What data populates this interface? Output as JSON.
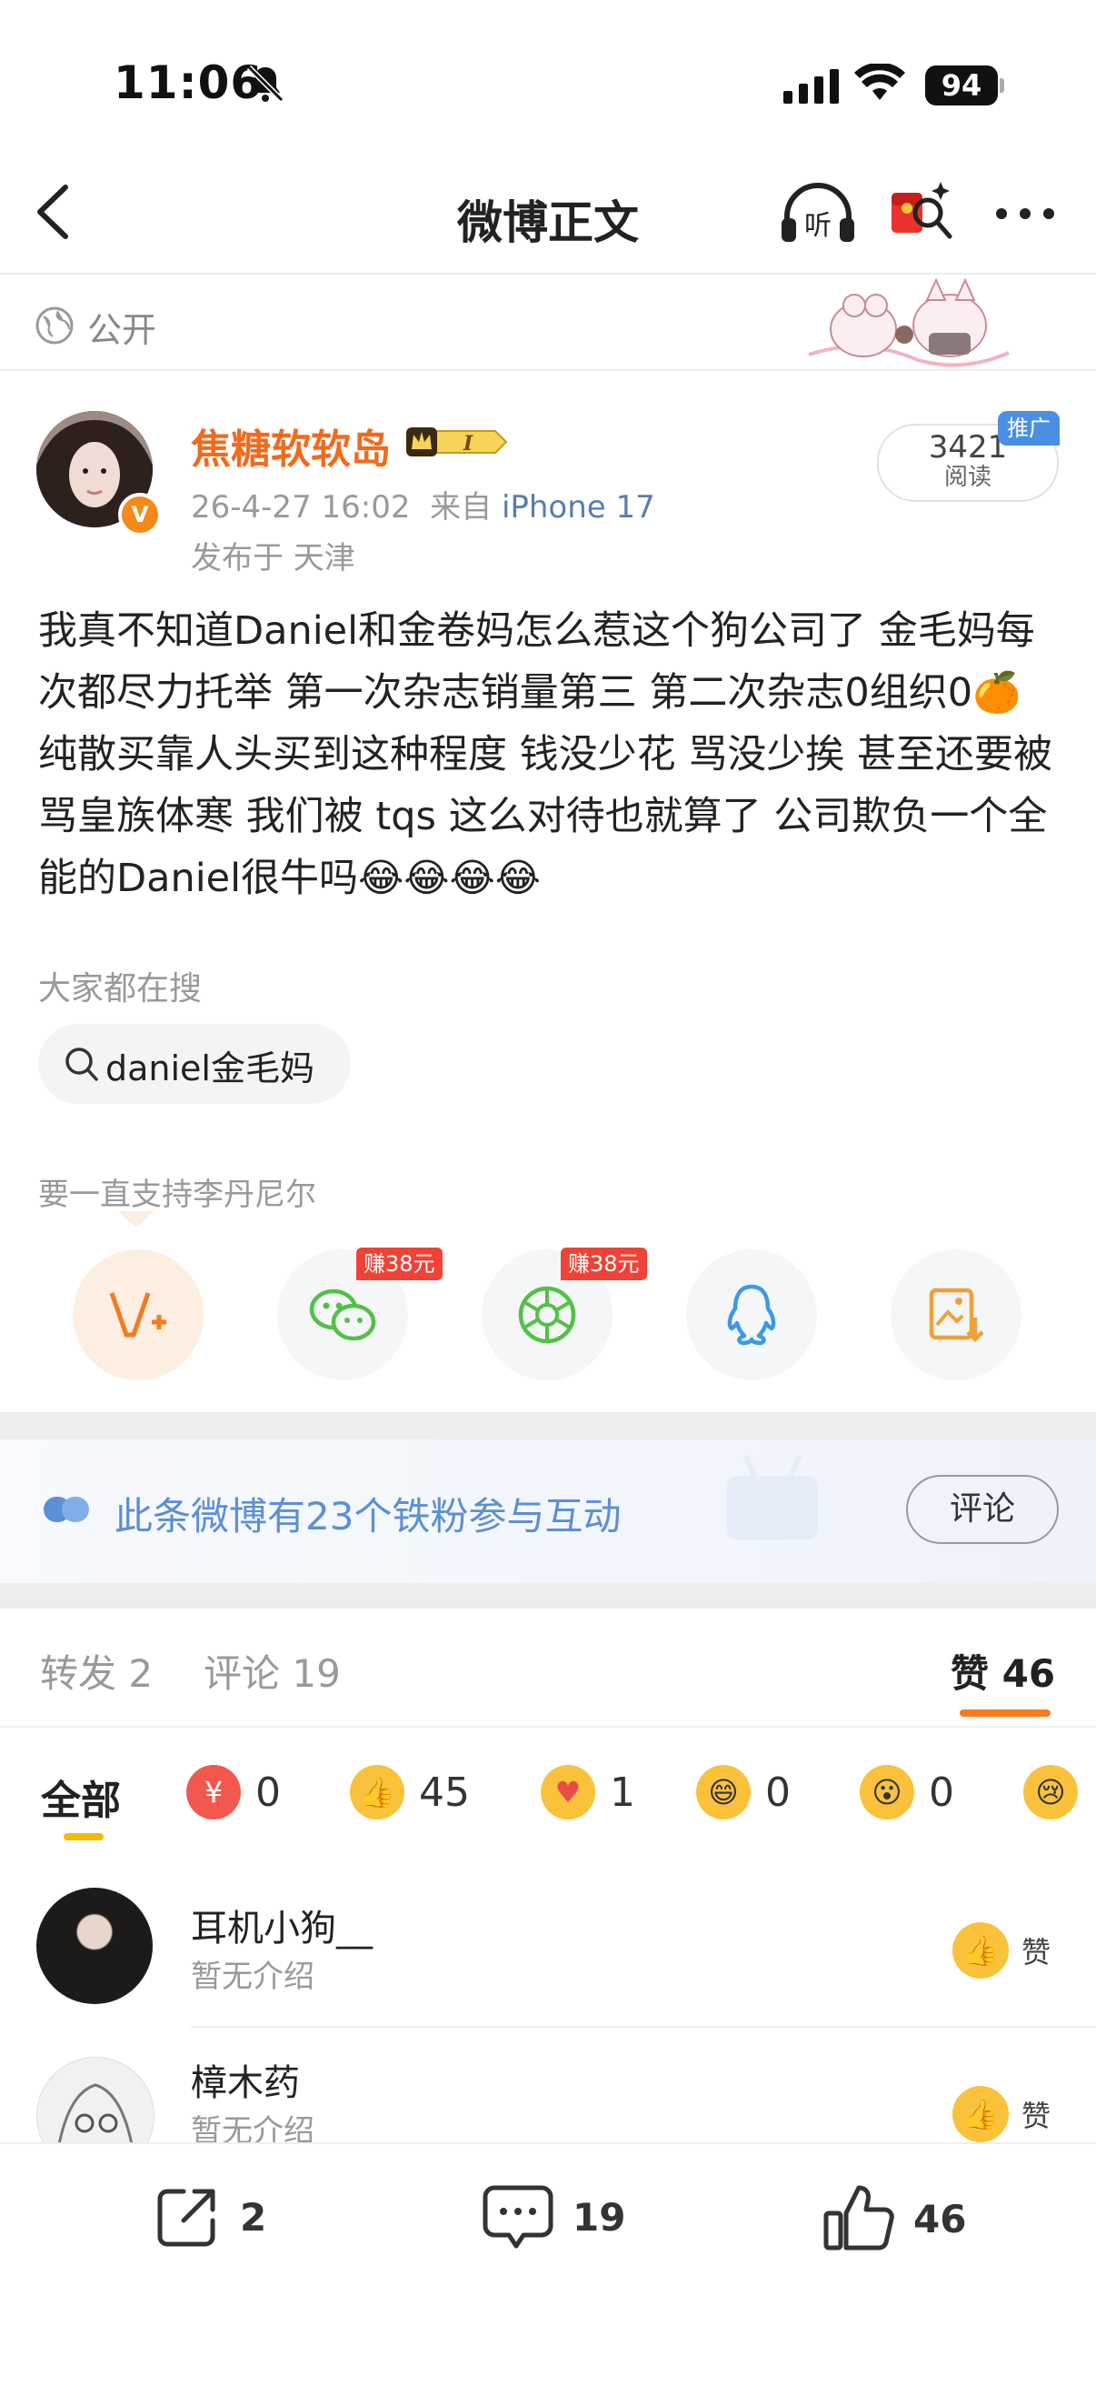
{
  "status_bar": {
    "time": "11:06",
    "battery": "94"
  },
  "nav": {
    "title": "微博正文"
  },
  "visibility": {
    "label": "公开"
  },
  "post": {
    "author": "焦糖软软岛",
    "vip_level": "I",
    "datetime": "26-4-27 16:02",
    "source_prefix": "来自",
    "source": "iPhone 17",
    "location": "发布于 天津",
    "read_count": "3421",
    "read_label": "阅读",
    "promo_tag": "推广",
    "body": "我真不知道Daniel和金卷妈怎么惹这个狗公司了 金毛妈每次都尽力托举 第一次杂志销量第三 第二次杂志0组织0🍊 纯散买靠人头买到这种程度 钱没少花 骂没少挨 甚至还要被骂皇族体寒 我们被 tqs 这么对待也就算了 公司欺负一个全能的Daniel很牛吗😂😂😂😂"
  },
  "search": {
    "heading": "大家都在搜",
    "chip": "daniel金毛妈"
  },
  "support": {
    "text": "要一直支持李丹尼尔"
  },
  "share": {
    "items": [
      {
        "name": "weibo-forward",
        "icon": "weibo-v-plus-icon",
        "color": "#f47b1e"
      },
      {
        "name": "wechat",
        "icon": "wechat-icon",
        "color": "#52c147",
        "earn": "赚38元"
      },
      {
        "name": "moments",
        "icon": "moments-aperture-icon",
        "color": "#52c147",
        "earn": "赚38元"
      },
      {
        "name": "qq",
        "icon": "qq-icon",
        "color": "#3a9ae8"
      },
      {
        "name": "save-image",
        "icon": "save-image-icon",
        "color": "#f0a03a"
      }
    ]
  },
  "fans_banner": {
    "text": "此条微博有23个铁粉参与互动",
    "button": "评论"
  },
  "tabs": {
    "repost_label": "转发",
    "repost_count": "2",
    "comment_label": "评论",
    "comment_count": "19",
    "like_label": "赞",
    "like_count": "46"
  },
  "reactions": {
    "all_label": "全部",
    "items": [
      {
        "icon": "red-envelope-heart-icon",
        "count": "0"
      },
      {
        "icon": "thumbs-up-icon",
        "count": "45"
      },
      {
        "icon": "heart-message-icon",
        "count": "1"
      },
      {
        "icon": "laughing-face-icon",
        "count": "0"
      },
      {
        "icon": "surprised-face-icon",
        "count": "0"
      },
      {
        "icon": "sad-face-icon",
        "count": ""
      }
    ]
  },
  "likers": [
    {
      "name": "耳机小狗__",
      "bio": "暂无介绍",
      "action": "赞"
    },
    {
      "name": "樟木药",
      "bio": "暂无介绍",
      "action": "赞"
    }
  ],
  "bottom_bar": {
    "repost": "2",
    "comment": "19",
    "like": "46"
  }
}
